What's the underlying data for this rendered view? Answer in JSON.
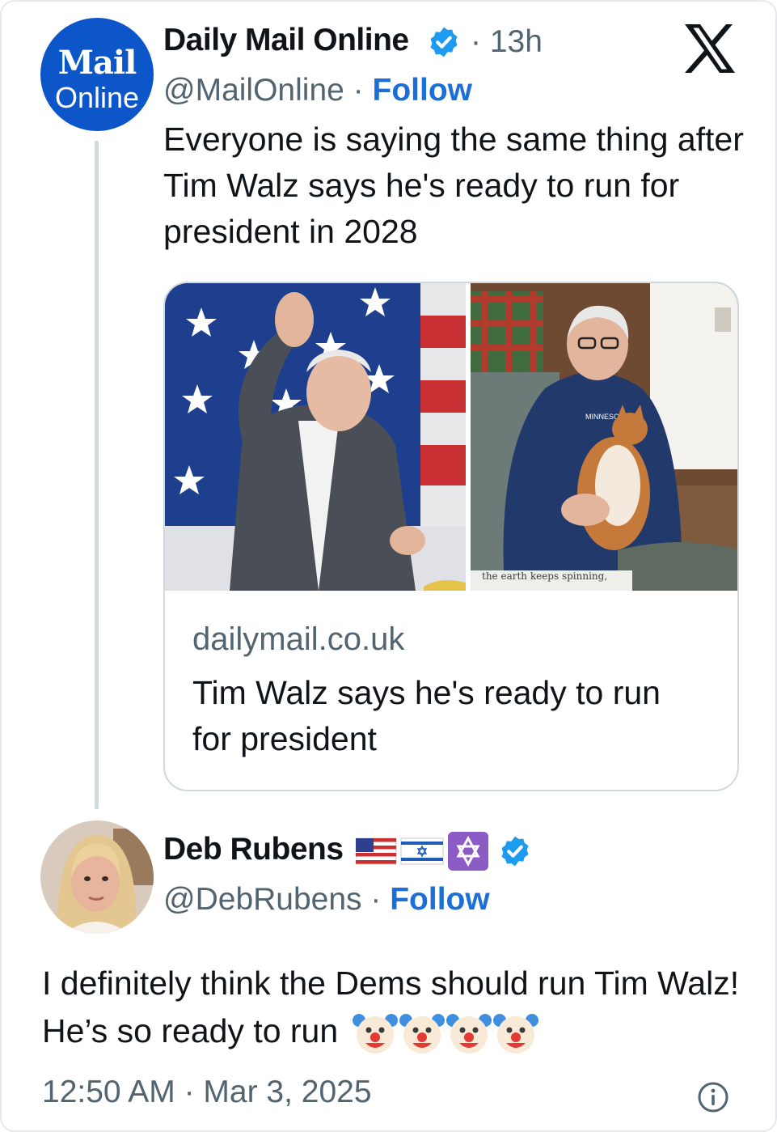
{
  "tweet": {
    "avatar": {
      "line1": "Mail",
      "line2": "Online",
      "bg": "#0d56c9"
    },
    "author_name": "Daily Mail Online",
    "time": "· 13h",
    "handle": "@MailOnline",
    "sep": " · ",
    "follow_label": "Follow",
    "text": "Everyone is saying the same thing after Tim Walz says he's ready to run for president in 2028",
    "link_card": {
      "image_caption": "the earth keeps spinning,",
      "shirt_text": "MINNESOTA",
      "domain": "dailymail.co.uk",
      "title": "Tim Walz says he's ready to run for president"
    }
  },
  "reply": {
    "author_name": "Deb Rubens",
    "handle": "@DebRubens",
    "sep": " · ",
    "follow_label": "Follow",
    "text": "I definitely think the Dems should run Tim Walz!  He’s so ready to run",
    "timestamp": "12:50 AM · Mar 3, 2025"
  },
  "colors": {
    "follow": "#1d6fd8",
    "verified": "#1d9bf0",
    "muted": "#536471",
    "border": "#cfd9de"
  },
  "icons": [
    "x-logo-icon",
    "verified-badge-icon",
    "us-flag-icon",
    "israel-flag-icon",
    "star-of-david-icon",
    "clown-face-icon",
    "info-icon"
  ]
}
